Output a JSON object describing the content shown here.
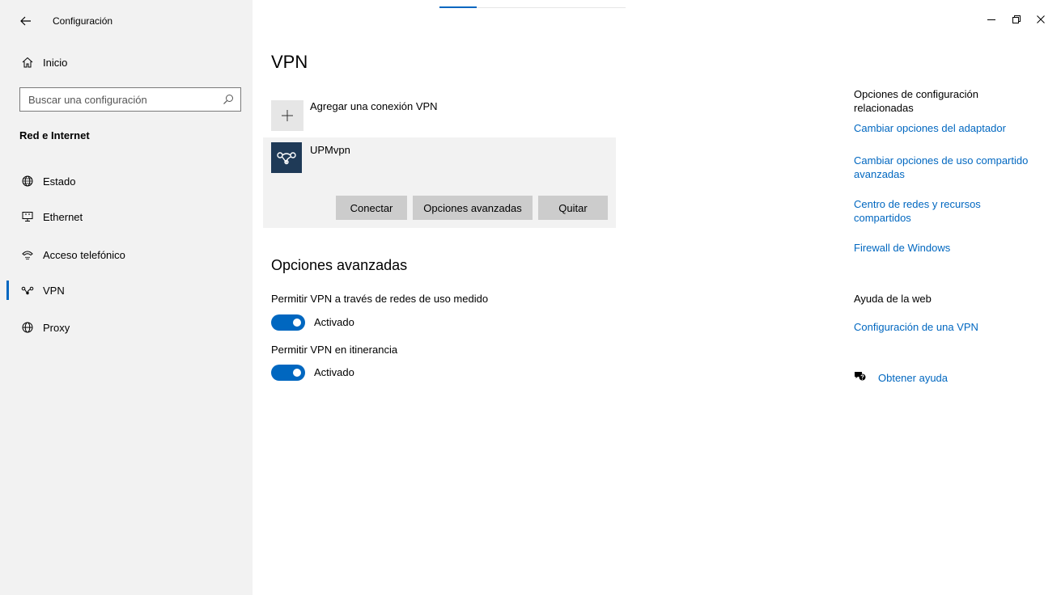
{
  "window": {
    "title": "Configuración",
    "back_icon": "back-arrow-icon",
    "controls": {
      "minimize": "–",
      "restore": "❐",
      "close": "✕"
    }
  },
  "sidebar": {
    "home_label": "Inicio",
    "search_placeholder": "Buscar una configuración",
    "section_title": "Red e Internet",
    "items": [
      {
        "label": "Estado",
        "icon": "status-globe-icon"
      },
      {
        "label": "Ethernet",
        "icon": "ethernet-icon"
      },
      {
        "label": "Acceso telefónico",
        "icon": "dialup-icon"
      },
      {
        "label": "VPN",
        "icon": "vpn-icon",
        "active": true
      },
      {
        "label": "Proxy",
        "icon": "proxy-globe-icon"
      }
    ]
  },
  "main": {
    "title": "VPN",
    "add_vpn_label": "Agregar una conexión VPN",
    "connection": {
      "name": "UPMvpn",
      "buttons": {
        "connect": "Conectar",
        "advanced": "Opciones avanzadas",
        "remove": "Quitar"
      }
    },
    "advanced": {
      "title": "Opciones avanzadas",
      "options": [
        {
          "label": "Permitir VPN a través de redes de uso medido",
          "state": "Activado",
          "on": true
        },
        {
          "label": "Permitir VPN en itinerancia",
          "state": "Activado",
          "on": true
        }
      ]
    }
  },
  "right": {
    "related_title": "Opciones de configuración relacionadas",
    "links": [
      "Cambiar opciones del adaptador",
      "Cambiar opciones de uso compartido avanzadas",
      "Centro de redes y recursos compartidos",
      "Firewall de Windows"
    ],
    "web_help_title": "Ayuda de la web",
    "web_help_link": "Configuración de una VPN",
    "get_help": "Obtener ayuda"
  },
  "colors": {
    "accent": "#0067c0",
    "sidebar_bg": "#f2f2f2",
    "button_bg": "#cccccc",
    "vpn_icon_bg": "#1f3a57"
  }
}
